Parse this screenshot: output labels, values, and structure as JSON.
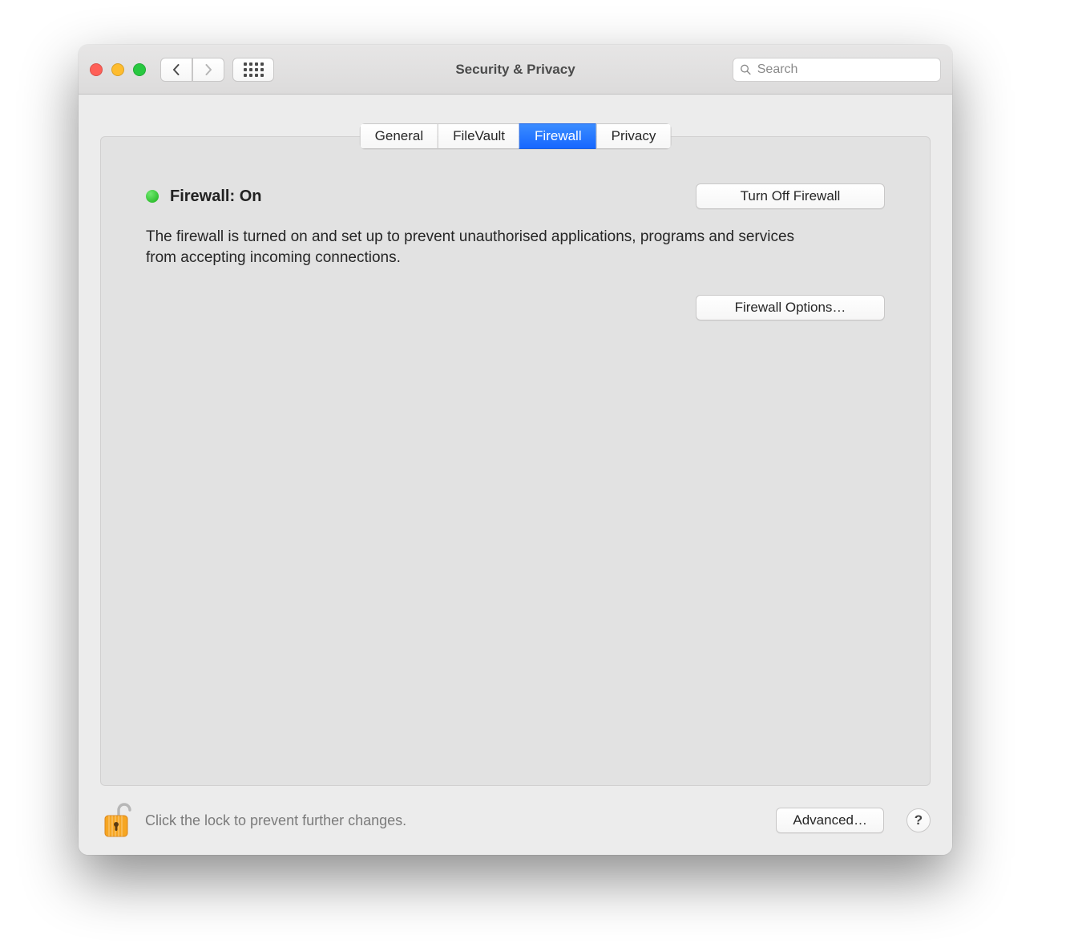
{
  "window": {
    "title": "Security & Privacy"
  },
  "toolbar": {
    "search_placeholder": "Search"
  },
  "tabs": {
    "general": "General",
    "filevault": "FileVault",
    "firewall": "Firewall",
    "privacy": "Privacy",
    "active": "firewall"
  },
  "firewall": {
    "status_label": "Firewall: On",
    "status_color": "#27c93f",
    "toggle_button": "Turn Off Firewall",
    "description": "The firewall is turned on and set up to prevent unauthorised applications, programs and services from accepting incoming connections.",
    "options_button": "Firewall Options…"
  },
  "footer": {
    "lock_hint": "Click the lock to prevent further changes.",
    "advanced_button": "Advanced…",
    "help_label": "?"
  }
}
